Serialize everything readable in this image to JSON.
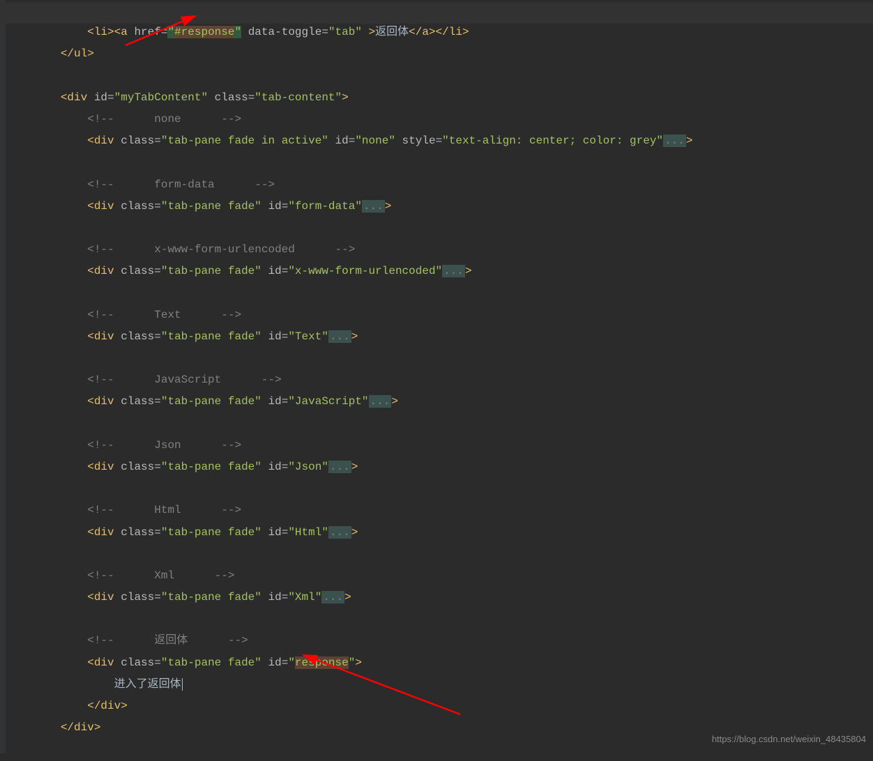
{
  "code": {
    "line1": {
      "li_open": "<li>",
      "a_open": "<a ",
      "href_attr": "href",
      "eq": "=",
      "q1": "\"",
      "href_val": "#response",
      "q2": "\" ",
      "dt_attr": "data-toggle",
      "dt_val": "\"tab\"",
      "a_close_gt": " >",
      "text": "返回体",
      "a_close": "</a>",
      "li_close": "</li>"
    },
    "line2": {
      "ul_close": "</ul>"
    },
    "line4": {
      "div_open": "<div ",
      "id_attr": "id",
      "id_val": "\"myTabContent\"",
      "class_attr": "class",
      "class_val": "\"tab-content\"",
      "gt": ">"
    },
    "cmt_none_open": "<!--",
    "cmt_none_txt": "none",
    "cmt_close": "-->",
    "div_open": "<div ",
    "class_attr": "class",
    "id_attr": "id",
    "style_attr": "style",
    "gt": ">",
    "fold": "...",
    "pane_none": {
      "class_val": "\"tab-pane fade in active\"",
      "id_val": "\"none\"",
      "style_val": "\"text-align: center; color: grey\""
    },
    "cmt_formdata": "form-data",
    "pane_formdata": {
      "class_val": "\"tab-pane fade\"",
      "id_val": "\"form-data\""
    },
    "cmt_urlenc": "x-www-form-urlencoded",
    "pane_urlenc": {
      "class_val": "\"tab-pane fade\"",
      "id_val": "\"x-www-form-urlencoded\""
    },
    "cmt_text": "Text",
    "pane_text": {
      "class_val": "\"tab-pane fade\"",
      "id_val": "\"Text\""
    },
    "cmt_js": "JavaScript",
    "pane_js": {
      "class_val": "\"tab-pane fade\"",
      "id_val": "\"JavaScript\""
    },
    "cmt_json": "Json",
    "pane_json": {
      "class_val": "\"tab-pane fade\"",
      "id_val": "\"Json\""
    },
    "cmt_html": "Html",
    "pane_html": {
      "class_val": "\"tab-pane fade\"",
      "id_val": "\"Html\""
    },
    "cmt_xml": "Xml",
    "pane_xml": {
      "class_val": "\"tab-pane fade\"",
      "id_val": "\"Xml\""
    },
    "cmt_resp": "返回体",
    "pane_resp": {
      "class_val": "\"tab-pane fade\"",
      "id_val_open": "\"",
      "id_val_word": "response",
      "id_val_close": "\""
    },
    "resp_body_text": "进入了返回体",
    "div_close": "</div>",
    "outer_div_close": "</div>"
  },
  "watermark": "https://blog.csdn.net/weixin_48435804"
}
